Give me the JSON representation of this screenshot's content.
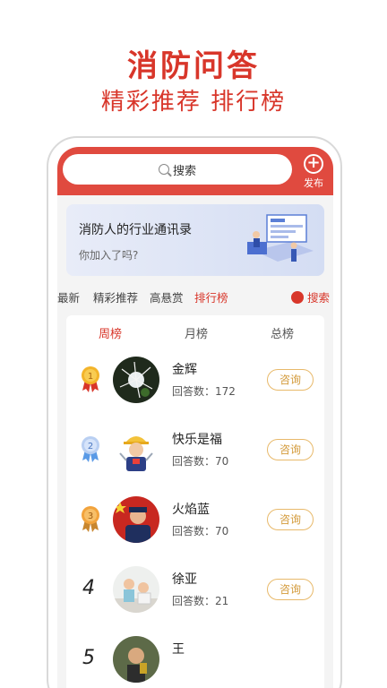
{
  "promo": {
    "title": "消防问答",
    "subtitle": "精彩推荐 排行榜"
  },
  "header": {
    "search_label": "搜索",
    "publish_label": "发布"
  },
  "banner": {
    "title": "消防人的行业通讯录",
    "subtitle": "你加入了吗?"
  },
  "tabs": [
    {
      "label": "最新",
      "active": false
    },
    {
      "label": "精彩推荐",
      "active": false
    },
    {
      "label": "高悬赏",
      "active": false
    },
    {
      "label": "排行榜",
      "active": true
    }
  ],
  "tabs_search_label": "搜索",
  "rank_tabs": [
    {
      "label": "周榜",
      "active": true
    },
    {
      "label": "月榜",
      "active": false
    },
    {
      "label": "总榜",
      "active": false
    }
  ],
  "answers_prefix": "回答数：",
  "consult_label": "咨询",
  "rankings": [
    {
      "rank": "1",
      "medal": "gold-medal-icon",
      "name": "金辉",
      "answers": "172"
    },
    {
      "rank": "2",
      "medal": "silver-medal-icon",
      "name": "快乐是福",
      "answers": "70"
    },
    {
      "rank": "3",
      "medal": "bronze-medal-icon",
      "name": "火焰蓝",
      "answers": "70"
    },
    {
      "rank": "4",
      "medal": "",
      "name": "徐亚",
      "answers": "21"
    },
    {
      "rank": "5",
      "medal": "",
      "name": "王",
      "answers": ""
    }
  ],
  "colors": {
    "brand": "#d8362a",
    "header": "#e04a3f",
    "consult": "#d39a3a"
  }
}
